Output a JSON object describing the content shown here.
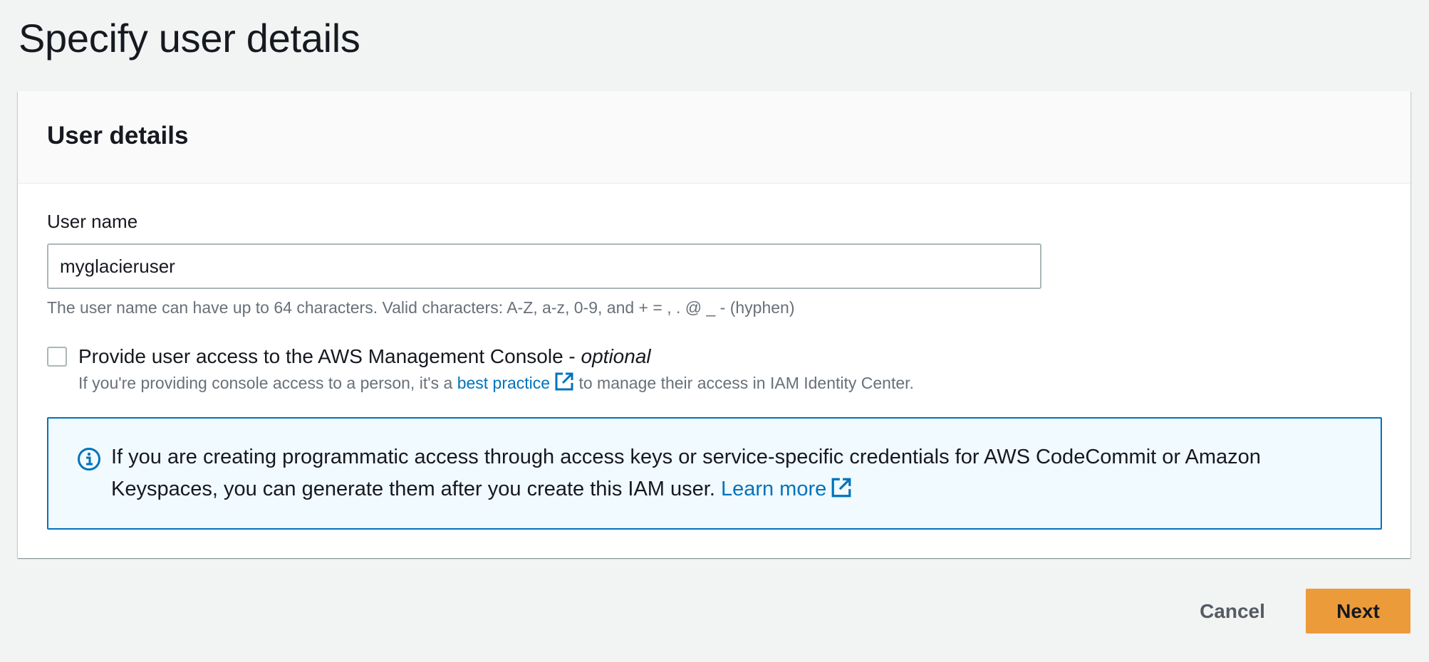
{
  "page": {
    "title": "Specify user details"
  },
  "card": {
    "title": "User details"
  },
  "user_name": {
    "label": "User name",
    "value": "myglacieruser",
    "hint": "The user name can have up to 64 characters. Valid characters: A-Z, a-z, 0-9, and + = , . @ _ - (hyphen)"
  },
  "console_access": {
    "checked": false,
    "label": "Provide user access to the AWS Management Console - ",
    "label_optional": "optional",
    "desc_before": "If you're providing console access to a person, it's a ",
    "desc_link": "best practice",
    "desc_after": " to manage their access in IAM Identity Center."
  },
  "info": {
    "text": "If you are creating programmatic access through access keys or service-specific credentials for AWS CodeCommit or Amazon Keyspaces, you can generate them after you create this IAM user. ",
    "link": "Learn more"
  },
  "actions": {
    "cancel": "Cancel",
    "next": "Next"
  },
  "colors": {
    "link": "#0073bb",
    "primary_button": "#ec9b3b",
    "info_border": "#0073bb",
    "info_background": "#f1faff",
    "page_background": "#f2f3f3"
  },
  "icons": {
    "external_link": "external-link-icon",
    "info": "info-icon"
  }
}
